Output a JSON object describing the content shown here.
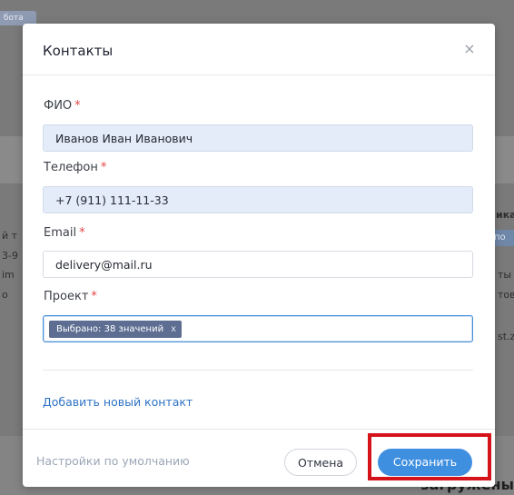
{
  "background": {
    "tag": "бота",
    "fragments_left": [
      "й т",
      "3-9",
      "im",
      "о"
    ],
    "fragments_right": [
      "ика",
      "ты",
      "тов",
      "st.z"
    ],
    "right_badge": "по",
    "bottom_text": "загружены"
  },
  "modal": {
    "title": "Контакты",
    "close_symbol": "×",
    "fields": {
      "fio": {
        "label": "ФИО",
        "required": "*",
        "value": "Иванов Иван Иванович"
      },
      "phone": {
        "label": "Телефон",
        "required": "*",
        "value": "+7 (911) 111-11-33"
      },
      "email": {
        "label": "Email",
        "required": "*",
        "value": "delivery@mail.ru"
      },
      "project": {
        "label": "Проект",
        "required": "*",
        "chip": "Выбрано: 38 значений",
        "chip_remove": "x"
      }
    },
    "add_contact": "Добавить новый контакт",
    "footer": {
      "defaults": "Настройки по умолчанию",
      "cancel": "Отмена",
      "save": "Сохранить"
    }
  },
  "colors": {
    "accent": "#3f8fe0",
    "required": "#e64545",
    "highlight": "#d5131b",
    "chip": "#5d6e92"
  }
}
